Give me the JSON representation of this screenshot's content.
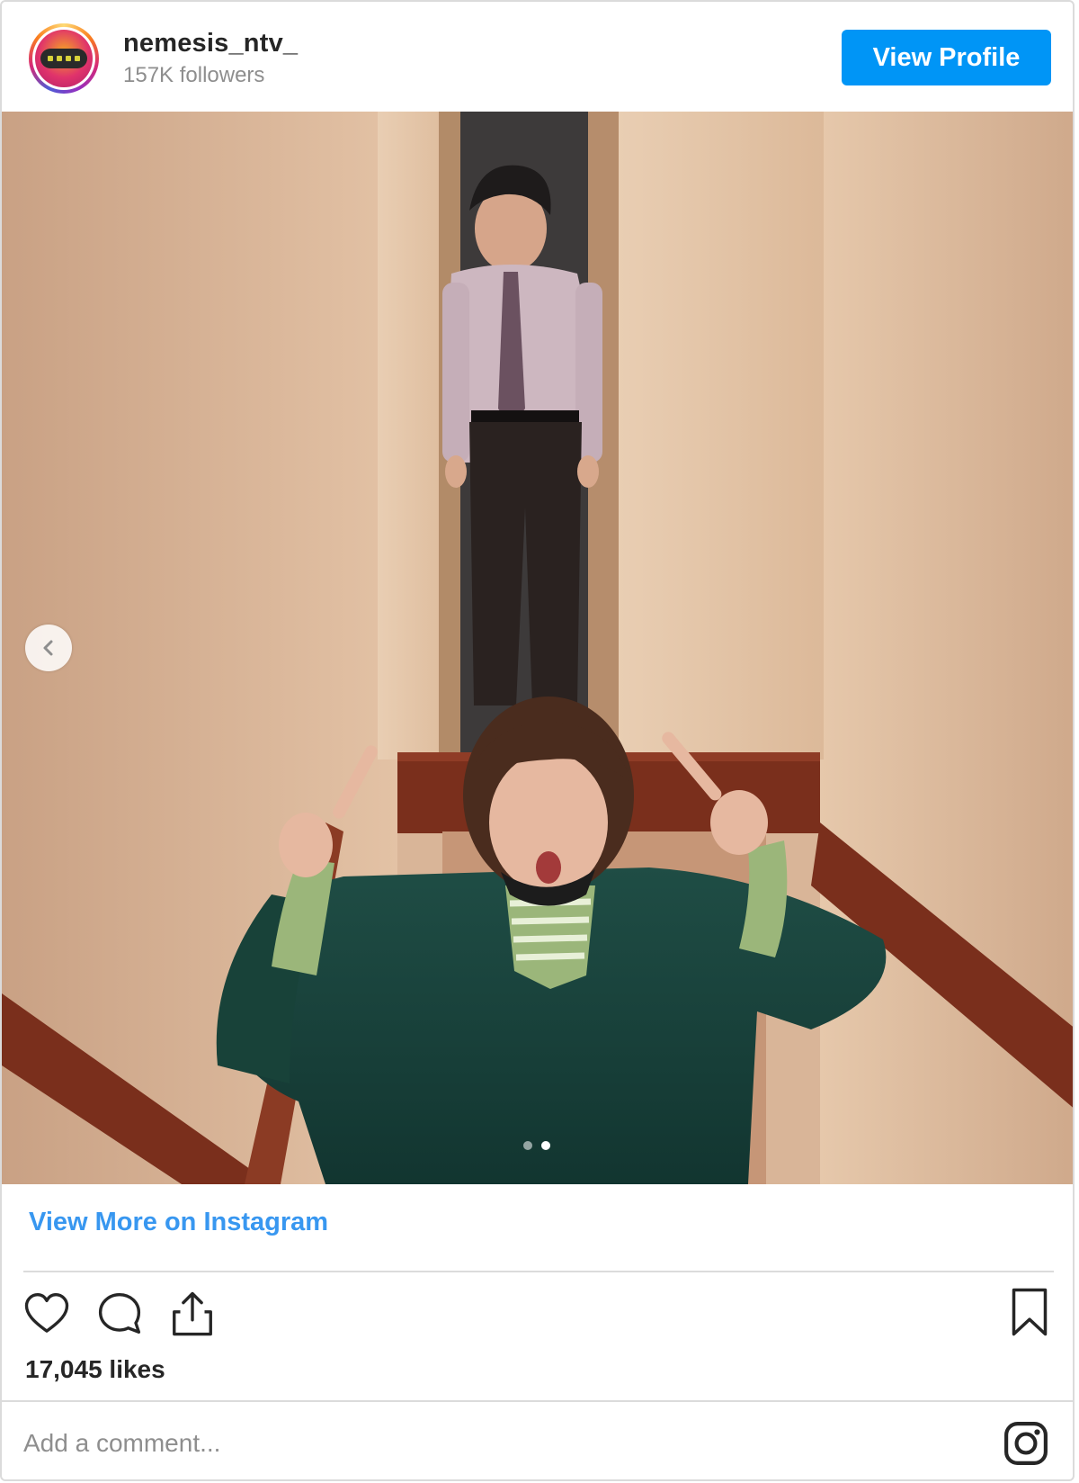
{
  "header": {
    "username": "nemesis_ntv_",
    "followers": "157K followers",
    "view_profile_label": "View Profile"
  },
  "post": {
    "image_icon": "photo",
    "carousel": {
      "slide_count": 2,
      "active_index": 1,
      "prev_icon": "chevron-left-icon"
    }
  },
  "footer": {
    "view_more_label": "View More on Instagram",
    "actions": [
      "heart-icon",
      "comment-icon",
      "share-icon"
    ],
    "save_icon": "bookmark-icon",
    "likes": "17,045 likes",
    "comment_placeholder": "Add a comment...",
    "brand_icon": "instagram-icon"
  },
  "colors": {
    "primary": "#0095f6",
    "link": "#3897f0",
    "text": "#262626",
    "muted": "#8e8e8e",
    "border": "#dbdbdb"
  }
}
